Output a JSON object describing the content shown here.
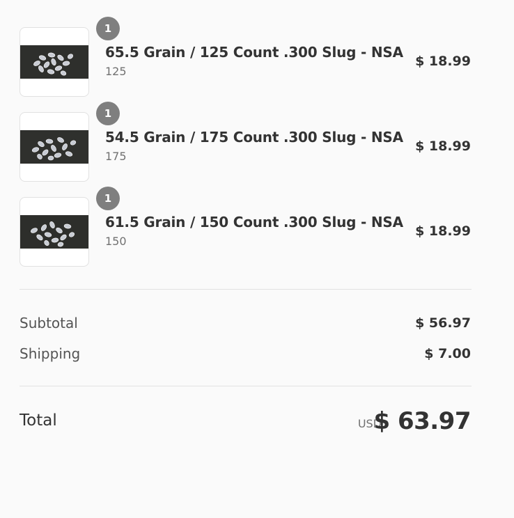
{
  "order_summary": {
    "items": [
      {
        "title": "65.5 Grain / 125 Count .300 Slug - NSA",
        "variant": "125",
        "quantity": "1",
        "price": "$ 18.99",
        "image": "bullet-slugs-photo"
      },
      {
        "title": "54.5 Grain / 175 Count .300 Slug - NSA",
        "variant": "175",
        "quantity": "1",
        "price": "$ 18.99",
        "image": "bullet-slugs-photo"
      },
      {
        "title": "61.5 Grain / 150 Count .300 Slug - NSA",
        "variant": "150",
        "quantity": "1",
        "price": "$ 18.99",
        "image": "bullet-slugs-photo"
      }
    ],
    "subtotal": {
      "label": "Subtotal",
      "value": "$ 56.97"
    },
    "shipping": {
      "label": "Shipping",
      "value": "$ 7.00"
    },
    "total": {
      "label": "Total",
      "currency": "USD",
      "value": "$ 63.97"
    }
  },
  "colors": {
    "background": "#fafafa",
    "badge": "#7f7f7f",
    "text": "#333333",
    "muted": "#717171",
    "divider": "#e1e1e1"
  }
}
